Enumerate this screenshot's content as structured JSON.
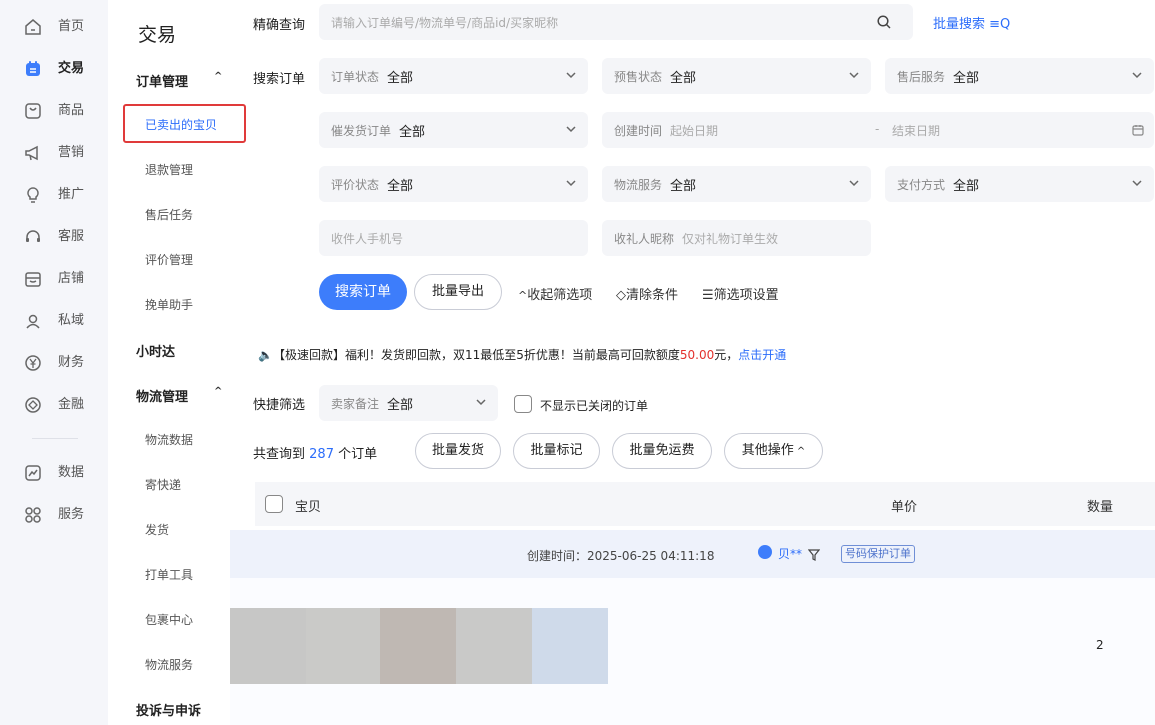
{
  "nav": {
    "items": [
      {
        "label": "首页",
        "icon": "home-icon"
      },
      {
        "label": "交易",
        "icon": "trade-icon",
        "active": true
      },
      {
        "label": "商品",
        "icon": "goods-icon"
      },
      {
        "label": "营销",
        "icon": "megaphone-icon"
      },
      {
        "label": "推广",
        "icon": "bulb-icon"
      },
      {
        "label": "客服",
        "icon": "headset-icon"
      },
      {
        "label": "店铺",
        "icon": "store-icon"
      },
      {
        "label": "私域",
        "icon": "users-icon"
      },
      {
        "label": "财务",
        "icon": "yen-icon"
      },
      {
        "label": "金融",
        "icon": "finance-icon"
      },
      {
        "label": "数据",
        "icon": "chart-icon"
      },
      {
        "label": "服务",
        "icon": "grid-icon"
      }
    ]
  },
  "submenu": {
    "title": "交易",
    "order_group": "订单管理",
    "order_items": [
      "已卖出的宝贝",
      "退款管理",
      "售后任务",
      "评价管理",
      "挽单助手"
    ],
    "xiaoshida": "小时达",
    "logistics_group": "物流管理",
    "logistics_items": [
      "物流数据",
      "寄快递",
      "发货",
      "打单工具",
      "包裹中心",
      "物流服务"
    ],
    "complaint": "投诉与申诉"
  },
  "search": {
    "label": "精确查询",
    "placeholder": "请输入订单编号/物流单号/商品id/买家昵称",
    "batch_search": "批量搜索"
  },
  "filters": {
    "row_label": "搜索订单",
    "order_status": {
      "label": "订单状态",
      "value": "全部"
    },
    "presale_status": {
      "label": "预售状态",
      "value": "全部"
    },
    "aftersale": {
      "label": "售后服务",
      "value": "全部"
    },
    "urge_ship": {
      "label": "催发货订单",
      "value": "全部"
    },
    "create_time": {
      "label": "创建时间",
      "start": "起始日期",
      "sep": "-",
      "end": "结束日期"
    },
    "review_status": {
      "label": "评价状态",
      "value": "全部"
    },
    "logistics_service": {
      "label": "物流服务",
      "value": "全部"
    },
    "payment": {
      "label": "支付方式",
      "value": "全部"
    },
    "receiver_phone": "收件人手机号",
    "gift_nick": {
      "label": "收礼人昵称",
      "hint": "仅对礼物订单生效"
    }
  },
  "actions": {
    "search": "搜索订单",
    "export": "批量导出",
    "collapse": "收起筛选项",
    "clear": "清除条件",
    "settings": "筛选项设置"
  },
  "notice": {
    "prefix": "【极速回款】福利！发货即回款，双11最低至5折优惠！当前最高可回款额度",
    "amount": "50.00",
    "suffix": "元，",
    "link": "点击开通"
  },
  "quick": {
    "label": "快捷筛选",
    "remark_label": "卖家备注",
    "remark_value": "全部",
    "hide_closed": "不显示已关闭的订单"
  },
  "summary": {
    "prefix": "共查询到",
    "count": "287",
    "suffix": "个订单",
    "buttons": [
      "批量发货",
      "批量标记",
      "批量免运费",
      "其他操作"
    ]
  },
  "table": {
    "col_item": "宝贝",
    "col_price": "单价",
    "col_qty": "数量"
  },
  "order": {
    "created": "创建时间：2025-06-25 04:11:18",
    "buyer": "贝**",
    "tag": "号码保护订单",
    "qty": "2"
  },
  "colors": {
    "primary": "#3d7dfb",
    "highlight_border": "#e03a3a",
    "price_red": "#e3312d"
  }
}
